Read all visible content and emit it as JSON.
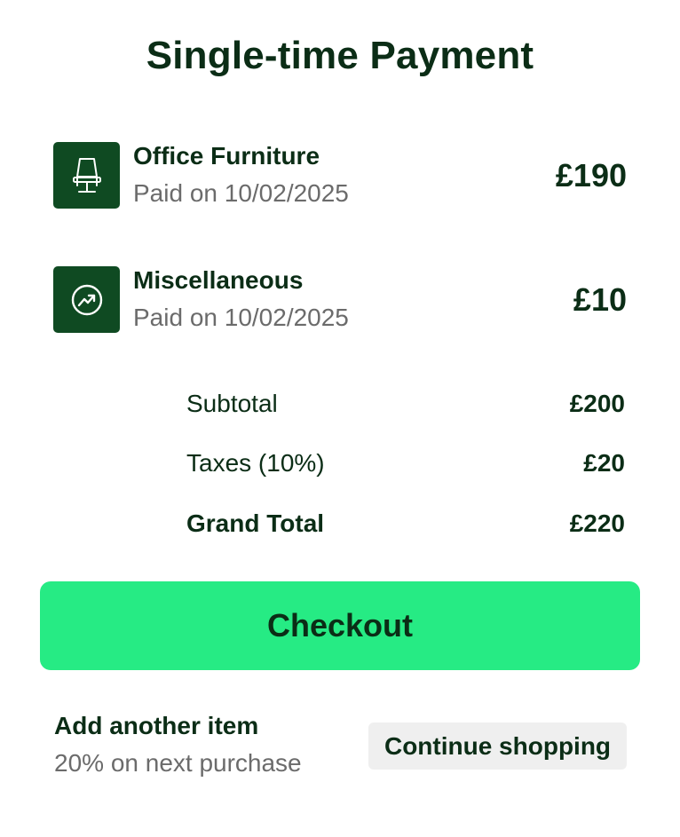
{
  "page": {
    "title": "Single-time Payment"
  },
  "items": [
    {
      "name": "Office Furniture",
      "date": "Paid on 10/02/2025",
      "price": "£190",
      "icon": "office-chair-icon"
    },
    {
      "name": "Miscellaneous",
      "date": "Paid on 10/02/2025",
      "price": "£10",
      "icon": "trending-up-circle-icon"
    }
  ],
  "summary": {
    "subtotal_label": "Subtotal",
    "subtotal_value": "£200",
    "taxes_label": "Taxes (10%)",
    "taxes_value": "£20",
    "total_label": "Grand Total",
    "total_value": "£220"
  },
  "checkout": {
    "label": "Checkout"
  },
  "footer": {
    "add_title": "Add another item",
    "add_subtitle": "20% on next purchase",
    "continue_label": "Continue shopping"
  },
  "colors": {
    "primary_dark": "#0b2d16",
    "icon_bg": "#0f4a22",
    "accent": "#26eb84",
    "muted_text": "#6b6b6b",
    "secondary_button_bg": "#efefef"
  }
}
